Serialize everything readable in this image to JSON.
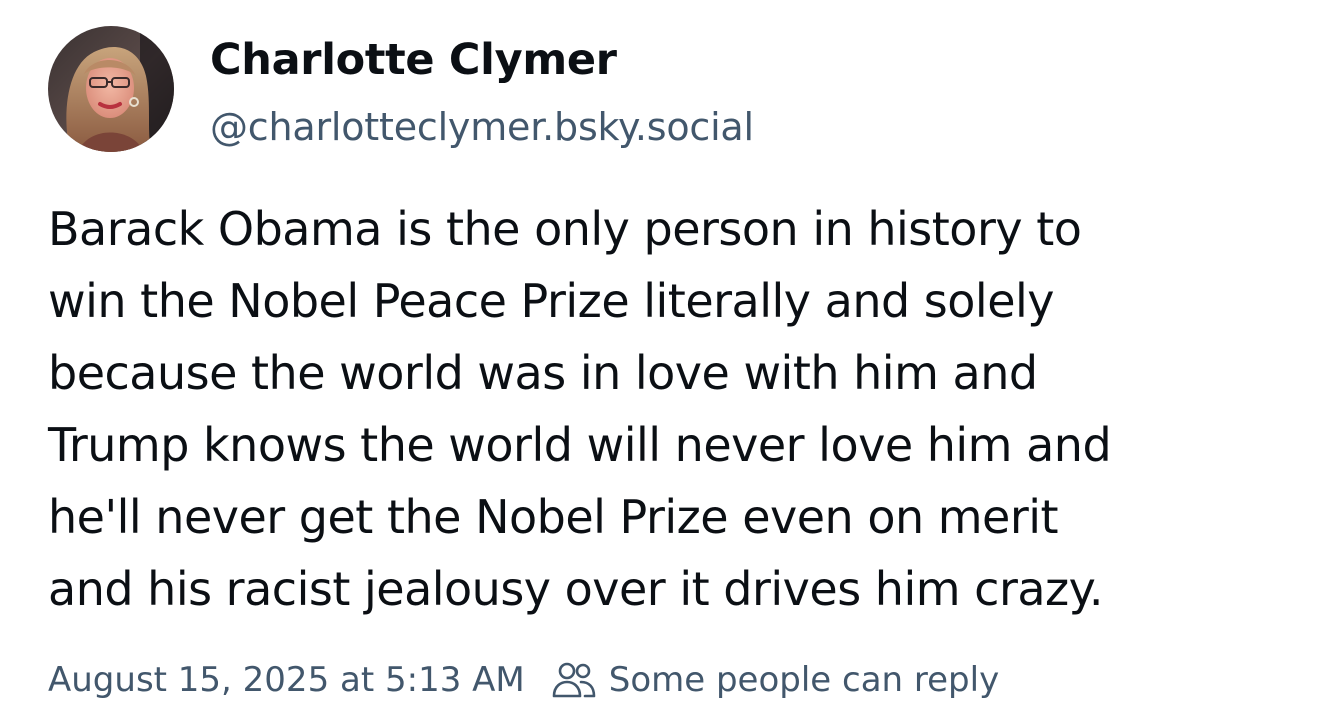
{
  "author": {
    "display_name": "Charlotte Clymer",
    "handle": "@charlotteclymer.bsky.social",
    "avatar_icon": "profile-photo"
  },
  "post": {
    "text": "Barack Obama is the only person in history to\nwin the Nobel Peace Prize literally and solely\nbecause the world was in love with him and\nTrump knows the world will never love him and\nhe'll never get the Nobel Prize even on merit\nand his racist jealousy over it drives him crazy."
  },
  "meta": {
    "timestamp": "August 15, 2025 at 5:13 AM",
    "reply_setting_icon": "people-icon",
    "reply_setting": "Some people can reply"
  },
  "colors": {
    "text": "#0b0f14",
    "secondary": "#42576c",
    "background": "#ffffff"
  }
}
